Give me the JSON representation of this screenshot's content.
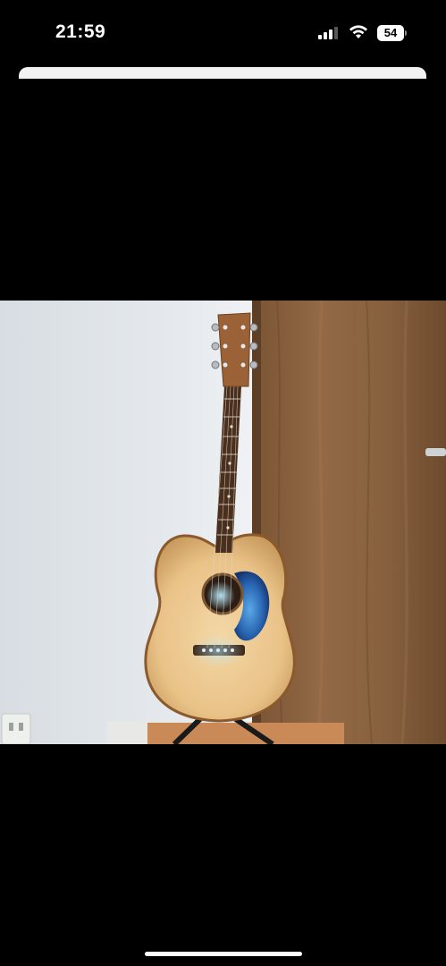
{
  "status_bar": {
    "time": "21:59",
    "battery_level": "54",
    "signal_icon": "cellular-signal-icon",
    "wifi_icon": "wifi-icon"
  },
  "photo": {
    "subject": "acoustic-guitar-photo"
  }
}
